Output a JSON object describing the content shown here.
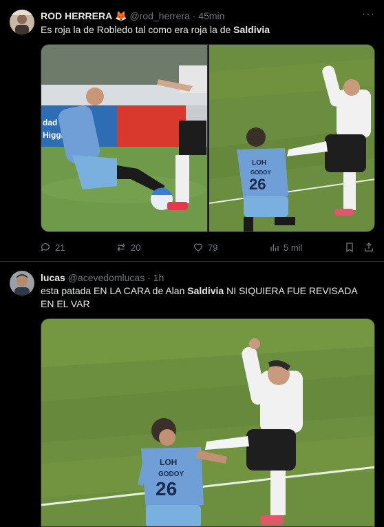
{
  "tweets": [
    {
      "author_name": "ROD HERRERA",
      "author_emoji": "🦊",
      "handle": "@rod_herrera",
      "sep": "·",
      "time": "45min",
      "more": "···",
      "text_pre": "Es roja la de Robledo tal como era roja la de ",
      "text_bold": "Saldivia",
      "text_post": "",
      "stats": {
        "replies": "21",
        "reposts": "20",
        "likes": "79",
        "views": "5 mil"
      }
    },
    {
      "author_name": "lucas",
      "handle": "@acevedomlucas",
      "sep": "·",
      "time": "1h",
      "text_pre": "esta patada EN LA CARA de Alan ",
      "text_bold": "Saldivia",
      "text_post": " NI SIQUIERA FUE REVISADA EN EL VAR"
    }
  ],
  "photo_lettering": {
    "sign_left": "dad Esp",
    "sign_left_2": "Higgin",
    "jersey_number": "26",
    "jersey_name": "GODOY",
    "jersey_sponsor": "LOH"
  },
  "colors": {
    "background": "#000000",
    "text": "#e7e9ea",
    "secondary": "#71767b",
    "divider": "#2f3336",
    "light_blue_kit": "#7fa9d9",
    "pitch_green": "#5f8a3a"
  }
}
